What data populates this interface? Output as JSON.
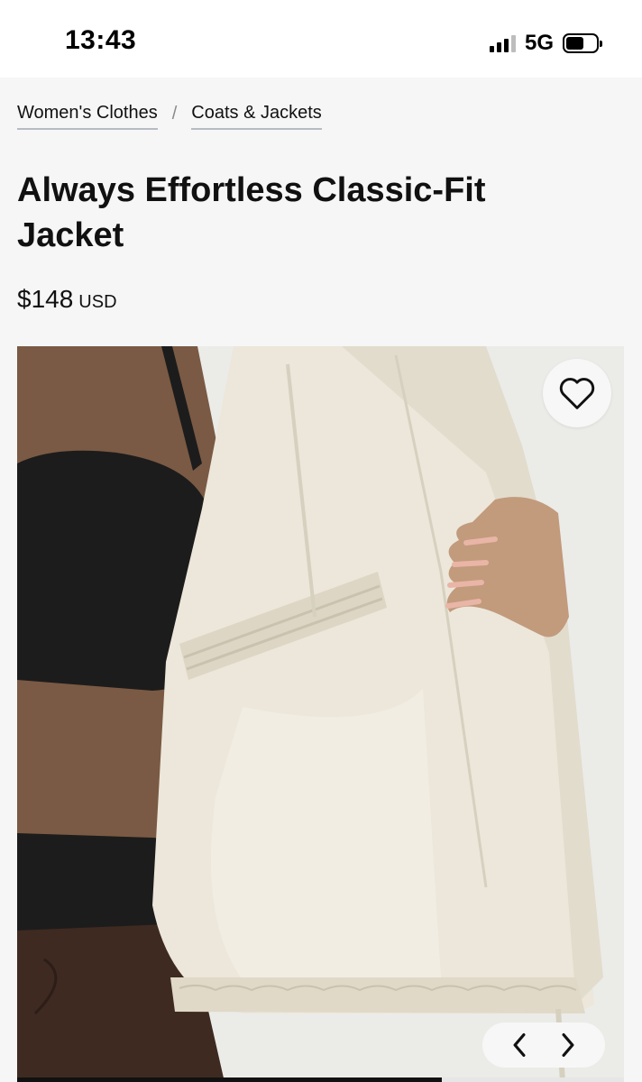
{
  "status_bar": {
    "time": "13:43",
    "network": "5G",
    "signal_icon": "signal-bars-icon",
    "battery_icon": "battery-icon"
  },
  "breadcrumb": [
    {
      "label": "Women's Clothes"
    },
    {
      "label": "Coats & Jackets"
    }
  ],
  "breadcrumb_separator": "/",
  "product": {
    "title": "Always Effortless Classic-Fit Jacket",
    "price": "$148",
    "currency": "USD"
  },
  "gallery": {
    "wishlist_icon": "heart-outline-icon",
    "prev_icon": "chevron-left-icon",
    "next_icon": "chevron-right-icon",
    "progress": 0.7,
    "colors": {
      "jacket": "#ece7da",
      "jacket_shadow": "#d6d0bf",
      "skin": "#7a5a44",
      "top": "#1d1c1c",
      "pants": "#3e2a21",
      "background": "#ebebe8"
    }
  }
}
